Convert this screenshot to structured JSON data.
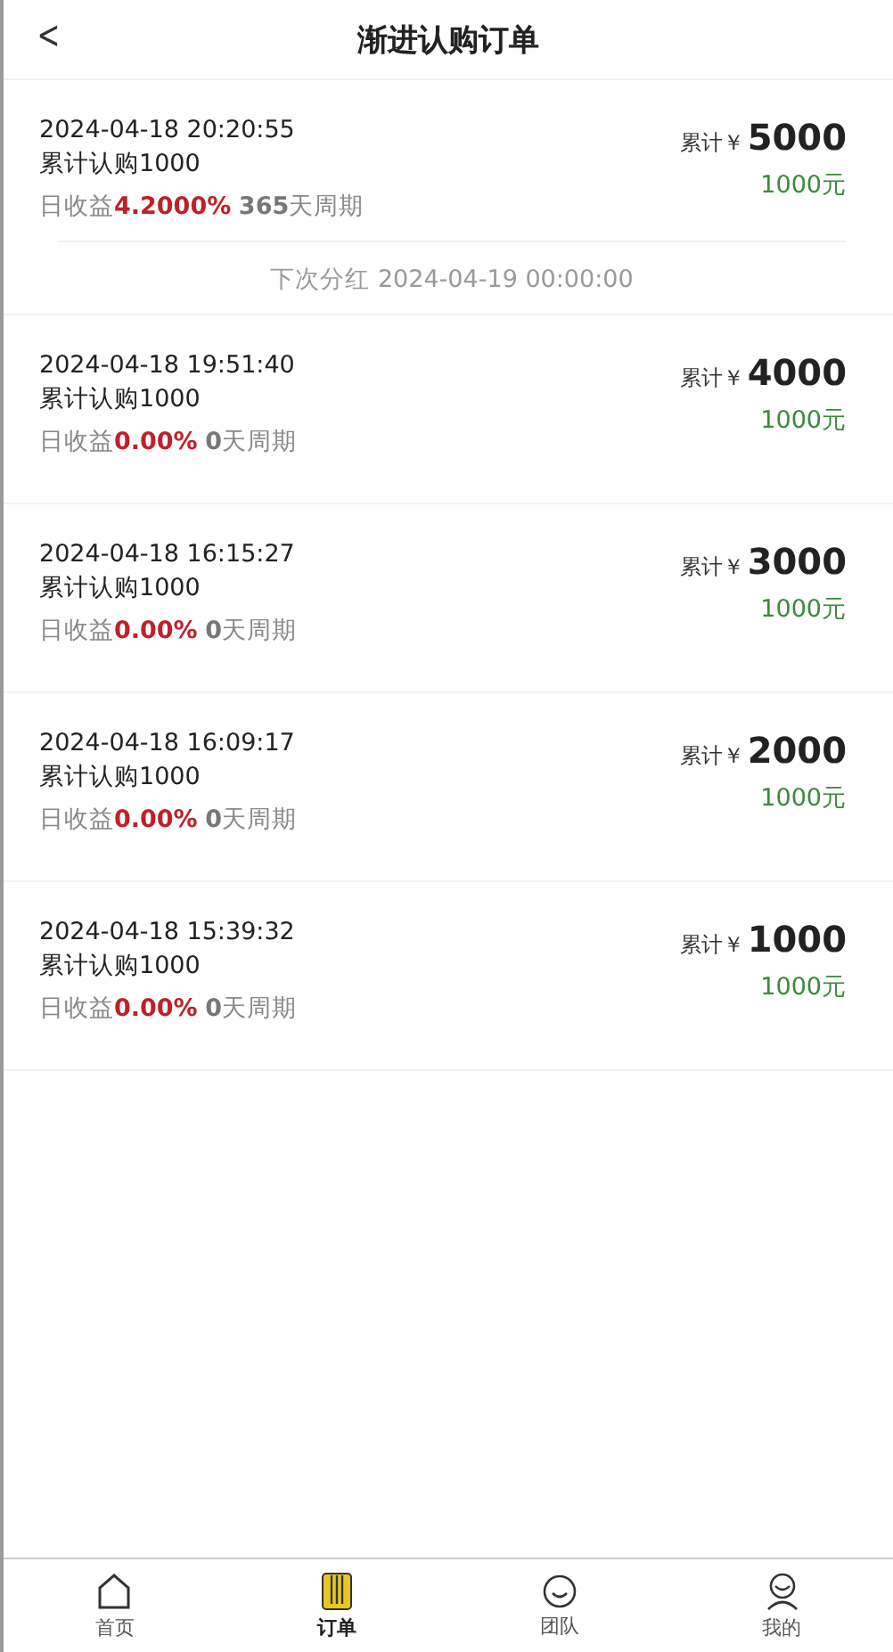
{
  "header": {
    "back": "<",
    "title": "渐进认购订单"
  },
  "orders": [
    {
      "time": "2024-04-18 20:20:55",
      "subscribed": "累计认购1000",
      "yield_label": "日收益",
      "rate": "4.2000%",
      "days": "365",
      "cycle": "天周期",
      "total_label": "累计￥",
      "total": "5000",
      "amount": "1000元",
      "next_dividend": "下次分红 2024-04-19 00:00:00"
    },
    {
      "time": "2024-04-18 19:51:40",
      "subscribed": "累计认购1000",
      "yield_label": "日收益",
      "rate": "0.00%",
      "days": "0",
      "cycle": "天周期",
      "total_label": "累计￥",
      "total": "4000",
      "amount": "1000元"
    },
    {
      "time": "2024-04-18 16:15:27",
      "subscribed": "累计认购1000",
      "yield_label": "日收益",
      "rate": "0.00%",
      "days": "0",
      "cycle": "天周期",
      "total_label": "累计￥",
      "total": "3000",
      "amount": "1000元"
    },
    {
      "time": "2024-04-18 16:09:17",
      "subscribed": "累计认购1000",
      "yield_label": "日收益",
      "rate": "0.00%",
      "days": "0",
      "cycle": "天周期",
      "total_label": "累计￥",
      "total": "2000",
      "amount": "1000元"
    },
    {
      "time": "2024-04-18 15:39:32",
      "subscribed": "累计认购1000",
      "yield_label": "日收益",
      "rate": "0.00%",
      "days": "0",
      "cycle": "天周期",
      "total_label": "累计￥",
      "total": "1000",
      "amount": "1000元"
    }
  ],
  "tab_bar": [
    {
      "kind": "home",
      "label": "首页",
      "selected": false
    },
    {
      "kind": "orders",
      "label": "订单",
      "selected": true
    },
    {
      "kind": "team",
      "label": "团队",
      "selected": false
    },
    {
      "kind": "profile",
      "label": "我的",
      "selected": false
    }
  ]
}
